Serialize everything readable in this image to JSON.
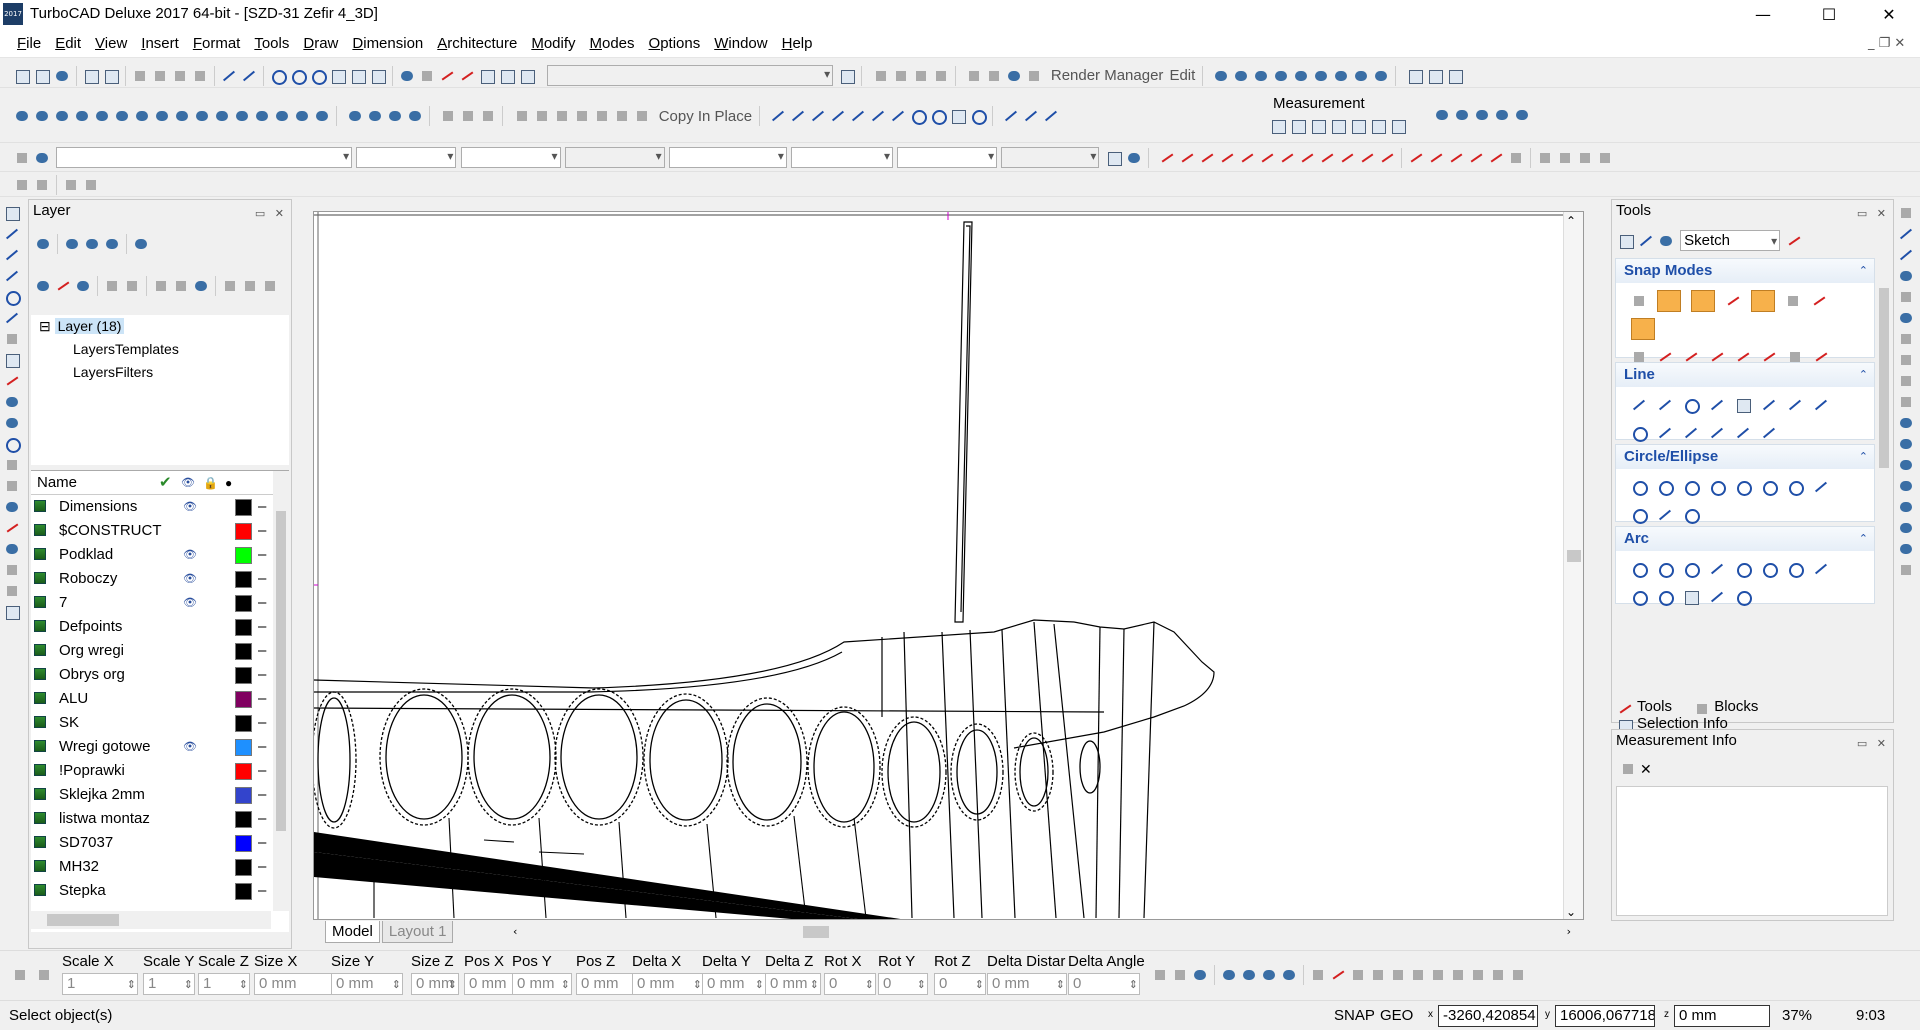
{
  "window": {
    "title": "TurboCAD Deluxe 2017 64-bit - [SZD-31 Zefir 4_3D]",
    "app_icon_text": "2017",
    "minimize": "—",
    "maximize": "☐",
    "close": "✕"
  },
  "menu": [
    "File",
    "Edit",
    "View",
    "Insert",
    "Format",
    "Tools",
    "Draw",
    "Dimension",
    "Architecture",
    "Modify",
    "Modes",
    "Options",
    "Window",
    "Help"
  ],
  "toolbar": {
    "render_manager": "Render Manager",
    "edit": "Edit",
    "copy_in_place": "Copy In Place",
    "measurement": "Measurement"
  },
  "layer_panel": {
    "title": "Layer",
    "tree": {
      "root": "Layer (18)",
      "templates": "LayersTemplates",
      "filters": "LayersFilters"
    },
    "columns": {
      "name": "Name"
    },
    "layers": [
      {
        "name": "Dimensions",
        "visible": true,
        "color": "#000000"
      },
      {
        "name": "$CONSTRUCT",
        "visible": false,
        "color": "#ff0000"
      },
      {
        "name": "Podklad",
        "visible": true,
        "color": "#00ff00"
      },
      {
        "name": "Roboczy",
        "visible": true,
        "color": "#000000"
      },
      {
        "name": "7",
        "visible": true,
        "color": "#000000"
      },
      {
        "name": "Defpoints",
        "visible": false,
        "color": "#000000"
      },
      {
        "name": "Org wregi",
        "visible": false,
        "color": "#000000"
      },
      {
        "name": "Obrys org",
        "visible": false,
        "color": "#000000"
      },
      {
        "name": "ALU",
        "visible": false,
        "color": "#800060"
      },
      {
        "name": "SK",
        "visible": false,
        "color": "#000000"
      },
      {
        "name": "Wregi gotowe",
        "visible": true,
        "color": "#1e90ff"
      },
      {
        "name": "!Poprawki",
        "visible": false,
        "color": "#ff0000"
      },
      {
        "name": "Sklejka 2mm",
        "visible": false,
        "color": "#3344cc"
      },
      {
        "name": "listwa montaz",
        "visible": false,
        "color": "#000000"
      },
      {
        "name": "SD7037",
        "visible": false,
        "color": "#0000ff"
      },
      {
        "name": "MH32",
        "visible": false,
        "color": "#000000"
      },
      {
        "name": "Stepka",
        "visible": false,
        "color": "#000000"
      }
    ]
  },
  "tools_panel": {
    "title": "Tools",
    "mode": "Sketch",
    "sections": {
      "snap": "Snap Modes",
      "line": "Line",
      "circle": "Circle/Ellipse",
      "arc": "Arc"
    },
    "tabs": [
      "Tools",
      "Blocks",
      "Selection Info"
    ]
  },
  "measurement_info": {
    "title": "Measurement Info"
  },
  "drawing_tabs": [
    "Model",
    "Layout 1"
  ],
  "inspector": {
    "fields": [
      {
        "label": "Scale X",
        "value": "1"
      },
      {
        "label": "Scale Y",
        "value": "1"
      },
      {
        "label": "Scale Z",
        "value": "1"
      },
      {
        "label": "Size X",
        "value": "0 mm"
      },
      {
        "label": "Size Y",
        "value": "0 mm"
      },
      {
        "label": "Size Z",
        "value": "0 mm"
      },
      {
        "label": "Pos X",
        "value": "0 mm"
      },
      {
        "label": "Pos Y",
        "value": "0 mm"
      },
      {
        "label": "Pos Z",
        "value": "0 mm"
      },
      {
        "label": "Delta X",
        "value": "0 mm"
      },
      {
        "label": "Delta Y",
        "value": "0 mm"
      },
      {
        "label": "Delta Z",
        "value": "0 mm"
      },
      {
        "label": "Rot X",
        "value": "0"
      },
      {
        "label": "Rot Y",
        "value": "0"
      },
      {
        "label": "Rot Z",
        "value": "0"
      },
      {
        "label": "Delta Distar",
        "value": "0 mm"
      },
      {
        "label": "Delta Angle",
        "value": "0"
      }
    ]
  },
  "status": {
    "message": "Select object(s)",
    "snap": "SNAP",
    "geo": "GEO",
    "x": "-3260,420854",
    "y": "16006,067718",
    "z": "0 mm",
    "zoom": "37%",
    "time": "9:03"
  }
}
